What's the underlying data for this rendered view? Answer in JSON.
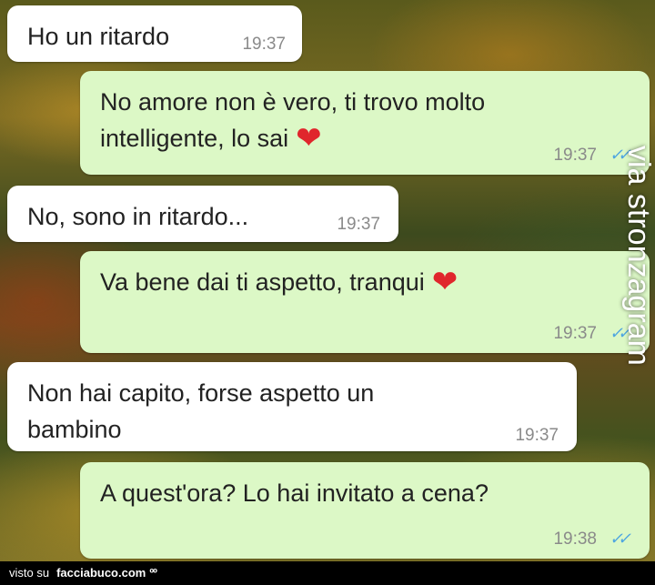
{
  "messages": [
    {
      "direction": "incoming",
      "text": "Ho un ritardo",
      "time": "19:37"
    },
    {
      "direction": "outgoing",
      "text": "No amore non è vero, ti trovo molto\nintelligente, lo sai",
      "emoji": "❤",
      "time": "19:37",
      "ticks": "✓✓"
    },
    {
      "direction": "incoming",
      "text": "No, sono in ritardo...",
      "time": "19:37"
    },
    {
      "direction": "outgoing",
      "text": "Va bene dai ti aspetto, tranqui",
      "emoji": "❤",
      "time": "19:37",
      "ticks": "✓✓"
    },
    {
      "direction": "incoming",
      "text": "Non hai capito, forse aspetto un\nbambino",
      "time": "19:37"
    },
    {
      "direction": "outgoing",
      "text": "A quest'ora? Lo hai invitato a cena?",
      "time": "19:38",
      "ticks": "✓✓"
    }
  ],
  "watermark": "via stronzagram",
  "footer": {
    "visto": "visto su",
    "site": "facciabuco.com",
    "eyes": "ºº"
  },
  "colors": {
    "incoming_bubble": "#ffffff",
    "outgoing_bubble": "#dcf8c6",
    "read_ticks": "#4fa6e0",
    "heart": "#e0262c"
  }
}
